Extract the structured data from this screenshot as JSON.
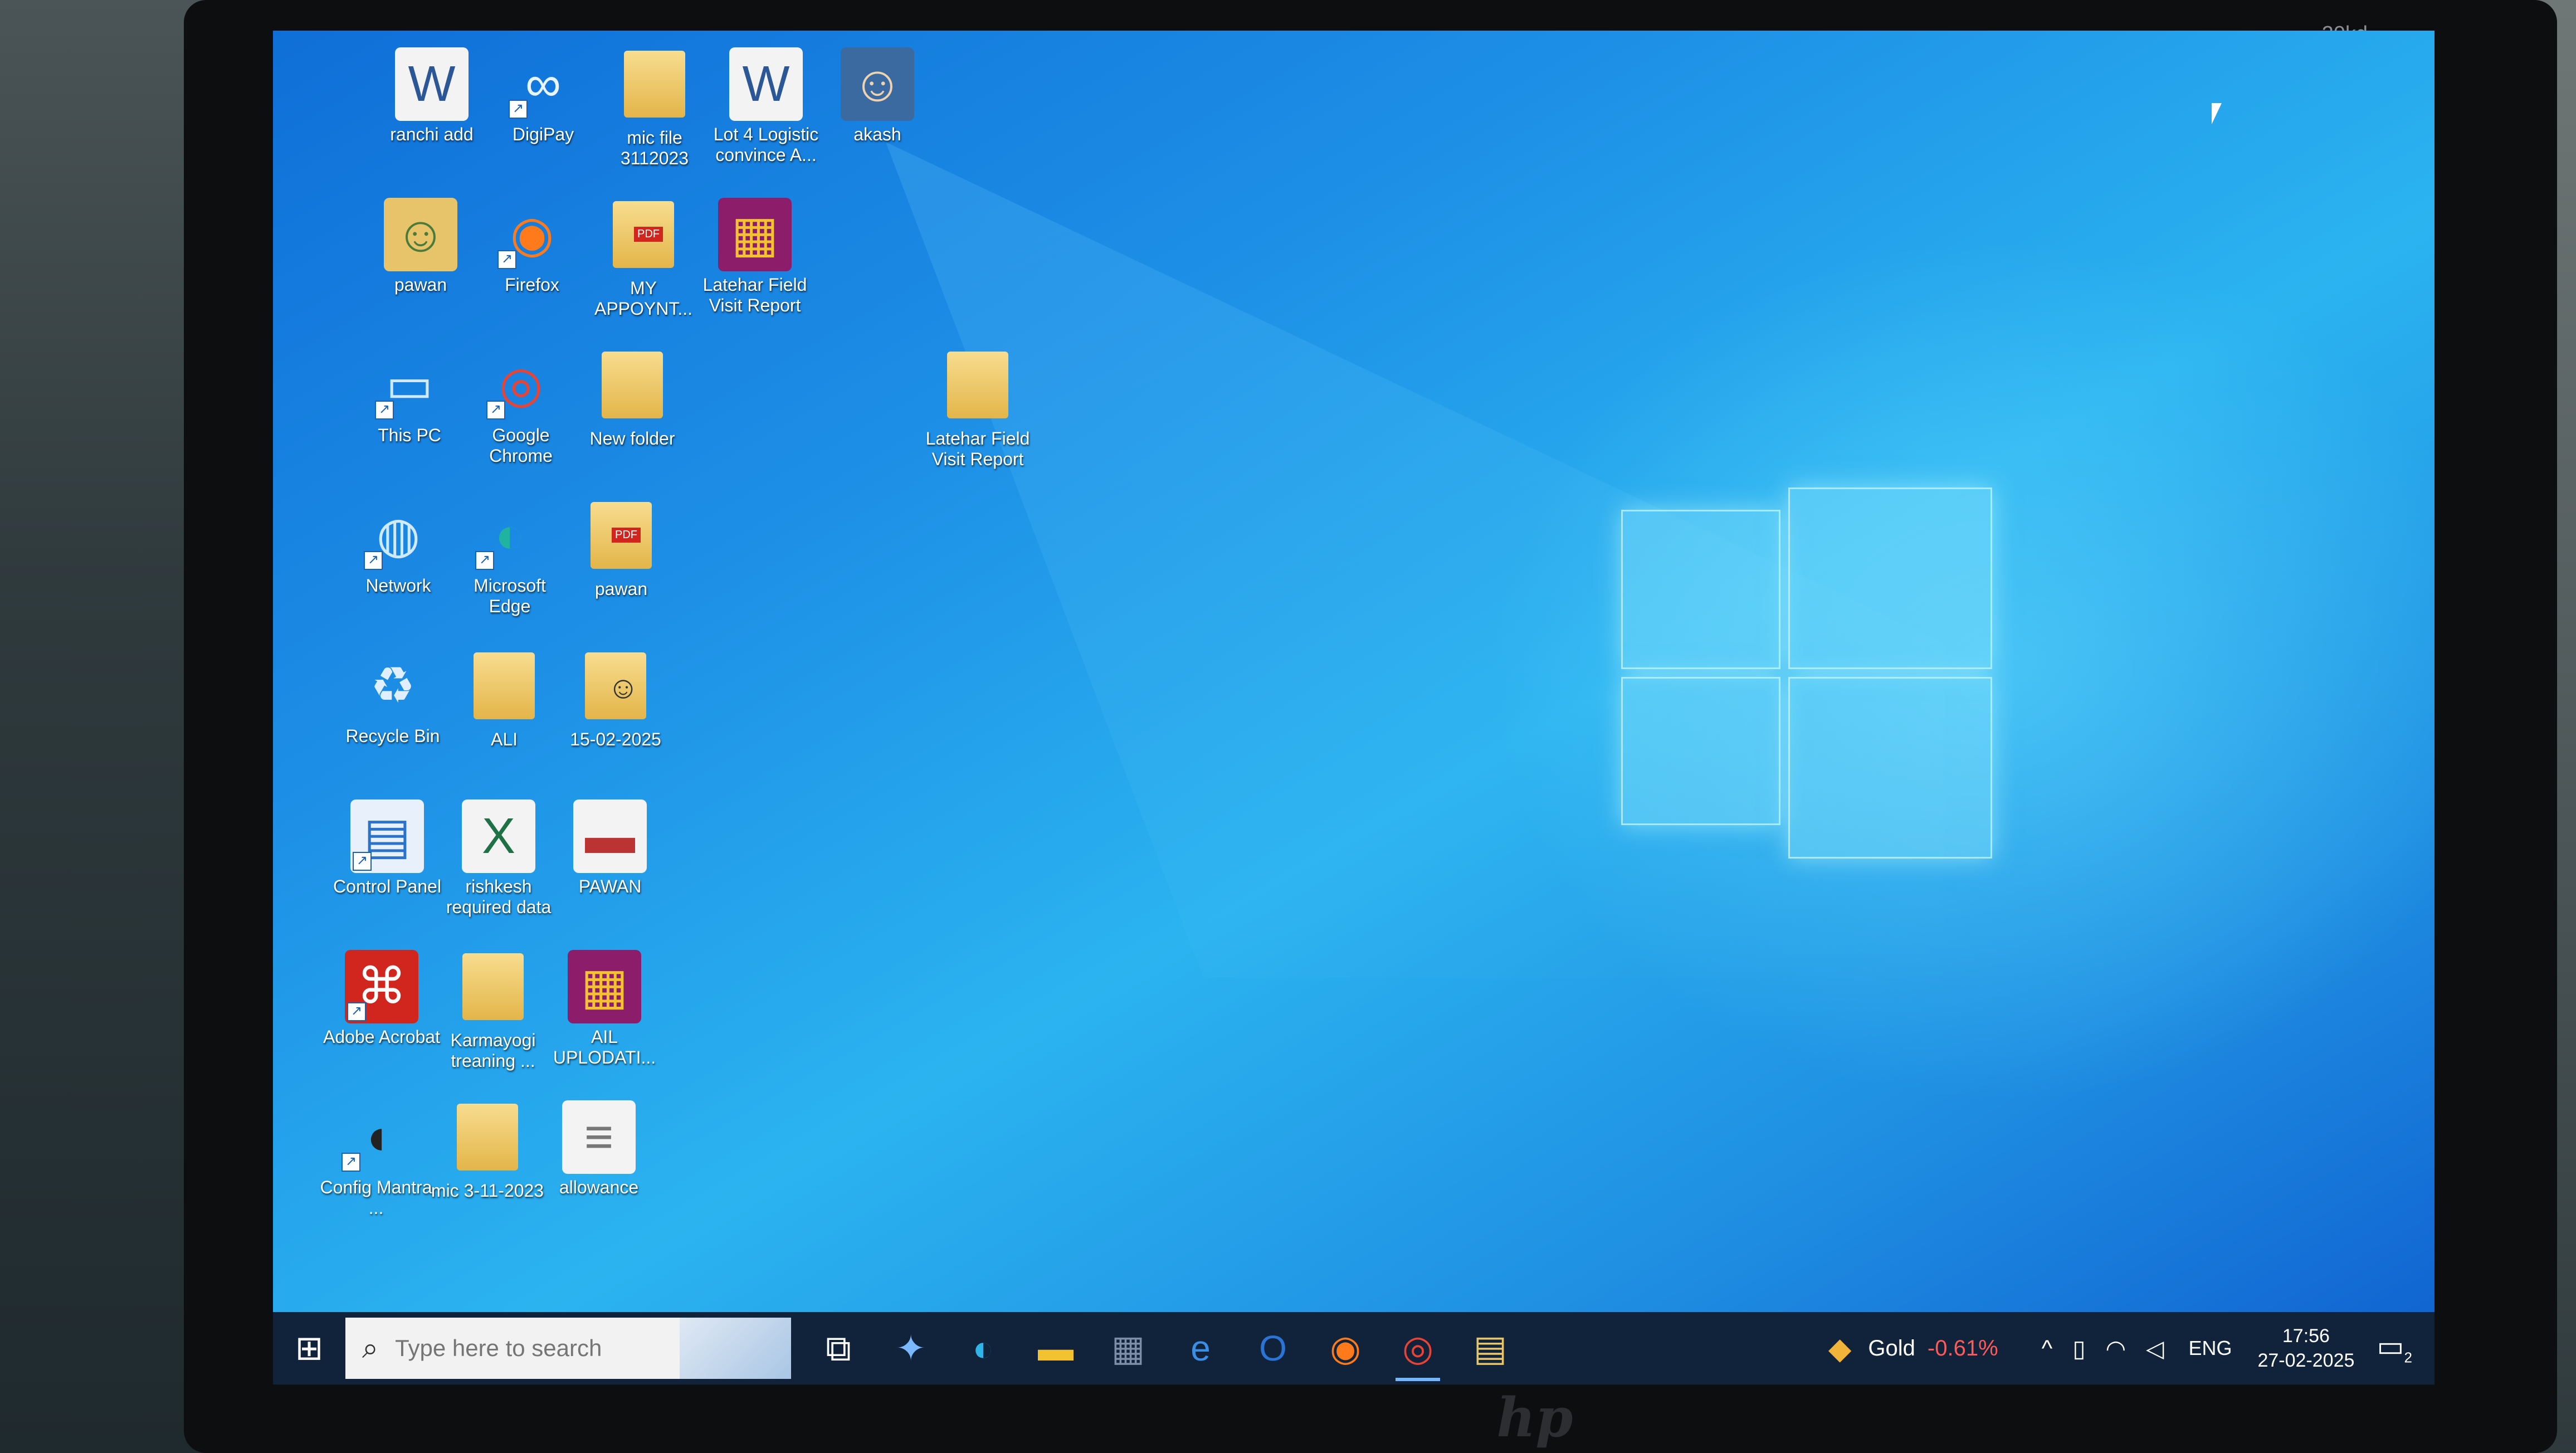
{
  "monitor": {
    "label": "20kd",
    "brand": "hp"
  },
  "desktop": {
    "icons": [
      {
        "label": "ranchi add",
        "kind": "document",
        "icon": "word-document-icon"
      },
      {
        "label": "DigiPay",
        "kind": "app",
        "icon": "digipay-icon"
      },
      {
        "label": "mic file 3112023",
        "kind": "folder",
        "icon": "folder-icon"
      },
      {
        "label": "Lot 4 Logistic convince A...",
        "kind": "document",
        "icon": "word-document-icon"
      },
      {
        "label": "akash",
        "kind": "image",
        "icon": "photo-icon"
      },
      {
        "label": "pawan",
        "kind": "user",
        "icon": "user-folder-icon"
      },
      {
        "label": "Firefox",
        "kind": "app",
        "icon": "firefox-icon"
      },
      {
        "label": "MY APPOYNT...",
        "kind": "folder",
        "icon": "folder-pdf-icon"
      },
      {
        "label": "Latehar Field Visit Report",
        "kind": "archive",
        "icon": "winrar-icon"
      },
      {
        "label": "This PC",
        "kind": "system",
        "icon": "this-pc-icon"
      },
      {
        "label": "Google Chrome",
        "kind": "app",
        "icon": "chrome-icon"
      },
      {
        "label": "New folder",
        "kind": "folder",
        "icon": "folder-icon"
      },
      {
        "label": "Latehar Field Visit Report",
        "kind": "folder",
        "icon": "folder-icon"
      },
      {
        "label": "Network",
        "kind": "system",
        "icon": "network-icon"
      },
      {
        "label": "Microsoft Edge",
        "kind": "app",
        "icon": "edge-icon"
      },
      {
        "label": "pawan",
        "kind": "folder",
        "icon": "folder-pdf-icon"
      },
      {
        "label": "Recycle Bin",
        "kind": "system",
        "icon": "recycle-bin-icon"
      },
      {
        "label": "ALI",
        "kind": "folder",
        "icon": "folder-icon"
      },
      {
        "label": "15-02-2025",
        "kind": "folder",
        "icon": "folder-photo-icon"
      },
      {
        "label": "Control Panel",
        "kind": "system",
        "icon": "control-panel-icon"
      },
      {
        "label": "rishkesh required data",
        "kind": "document",
        "icon": "excel-document-icon"
      },
      {
        "label": "PAWAN",
        "kind": "image",
        "icon": "image-file-icon"
      },
      {
        "label": "Adobe Acrobat",
        "kind": "app",
        "icon": "acrobat-icon"
      },
      {
        "label": "Karmayogi treaning ...",
        "kind": "folder",
        "icon": "folder-icon"
      },
      {
        "label": "AIL UPLODATI...",
        "kind": "archive",
        "icon": "winrar-icon"
      },
      {
        "label": "Config Mantra ...",
        "kind": "app",
        "icon": "fingerprint-scanner-icon"
      },
      {
        "label": "mic 3-11-2023",
        "kind": "folder",
        "icon": "folder-icon"
      },
      {
        "label": "allowance",
        "kind": "document",
        "icon": "document-icon"
      }
    ]
  },
  "taskbar": {
    "search_placeholder": "Type here to search",
    "apps": [
      {
        "name": "task-view",
        "glyph": "⧉"
      },
      {
        "name": "copilot",
        "glyph": "✦"
      },
      {
        "name": "edge",
        "glyph": "◐"
      },
      {
        "name": "file-explorer",
        "glyph": "▬"
      },
      {
        "name": "store",
        "glyph": "▦"
      },
      {
        "name": "internet-explorer",
        "glyph": "e"
      },
      {
        "name": "outlook",
        "glyph": "O"
      },
      {
        "name": "firefox",
        "glyph": "◉"
      },
      {
        "name": "chrome",
        "glyph": "◎"
      },
      {
        "name": "folder",
        "glyph": "▤"
      }
    ],
    "widget": {
      "name": "Gold",
      "change": "-0.61%"
    },
    "language": "ENG",
    "time": "17:56",
    "date": "27-02-2025",
    "notification_count": "2"
  },
  "colors": {
    "wallpaper_accent": "#1d8fe6",
    "taskbar": "#10233a",
    "negative": "#ff5a5a"
  }
}
